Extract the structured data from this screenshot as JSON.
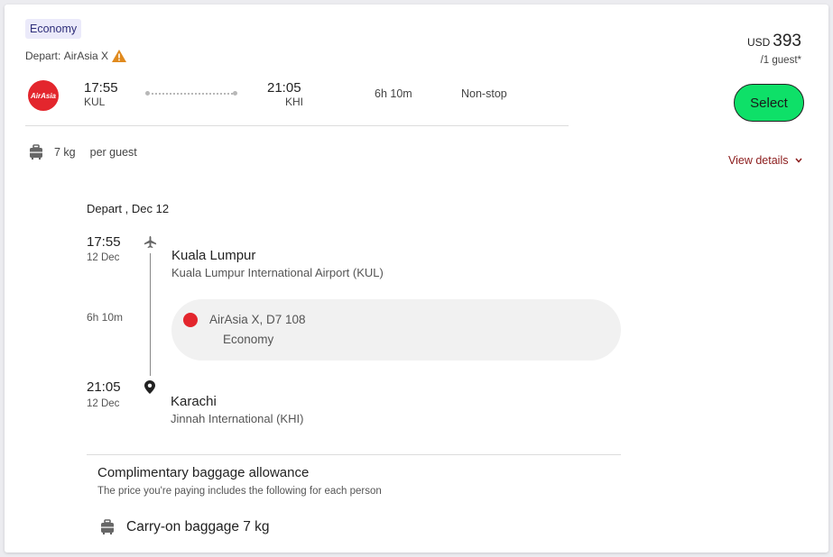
{
  "offer": {
    "cabin": "Economy",
    "depart_prefix": "Depart:",
    "airline": "AirAsia X",
    "logo_text": "AirAsia",
    "dep_time": "17:55",
    "dep_code": "KUL",
    "arr_time": "21:05",
    "arr_code": "KHI",
    "duration": "6h 10m",
    "stops": "Non-stop",
    "bag_weight": "7 kg",
    "bag_unit": "per guest"
  },
  "price": {
    "currency": "USD",
    "amount": "393",
    "per_guest": "/1 guest*",
    "select_label": "Select",
    "view_details_label": "View details"
  },
  "details": {
    "header": "Depart , Dec 12",
    "departure": {
      "time": "17:55",
      "date": "12 Dec",
      "city": "Kuala Lumpur",
      "airport": "Kuala Lumpur International Airport (KUL)"
    },
    "duration": "6h 10m",
    "segment": {
      "flight": "AirAsia X, D7 108",
      "cabin": "Economy"
    },
    "arrival": {
      "time": "21:05",
      "date": "12 Dec",
      "city": "Karachi",
      "airport": "Jinnah International (KHI)"
    }
  },
  "baggage": {
    "title": "Complimentary baggage allowance",
    "subtitle": "The price you're paying includes the following for each person",
    "carry_on": "Carry-on baggage 7 kg"
  },
  "colors": {
    "select_button": "#0ee068",
    "airline_red": "#e3262d",
    "view_details": "#8b1b1b",
    "warning": "#e08a1e",
    "badge_bg": "#ebeafa"
  },
  "icons": {
    "warning": "warning-triangle-icon",
    "luggage": "luggage-icon",
    "plane": "plane-icon",
    "pin": "location-pin-icon",
    "chevron": "chevron-down-icon"
  }
}
